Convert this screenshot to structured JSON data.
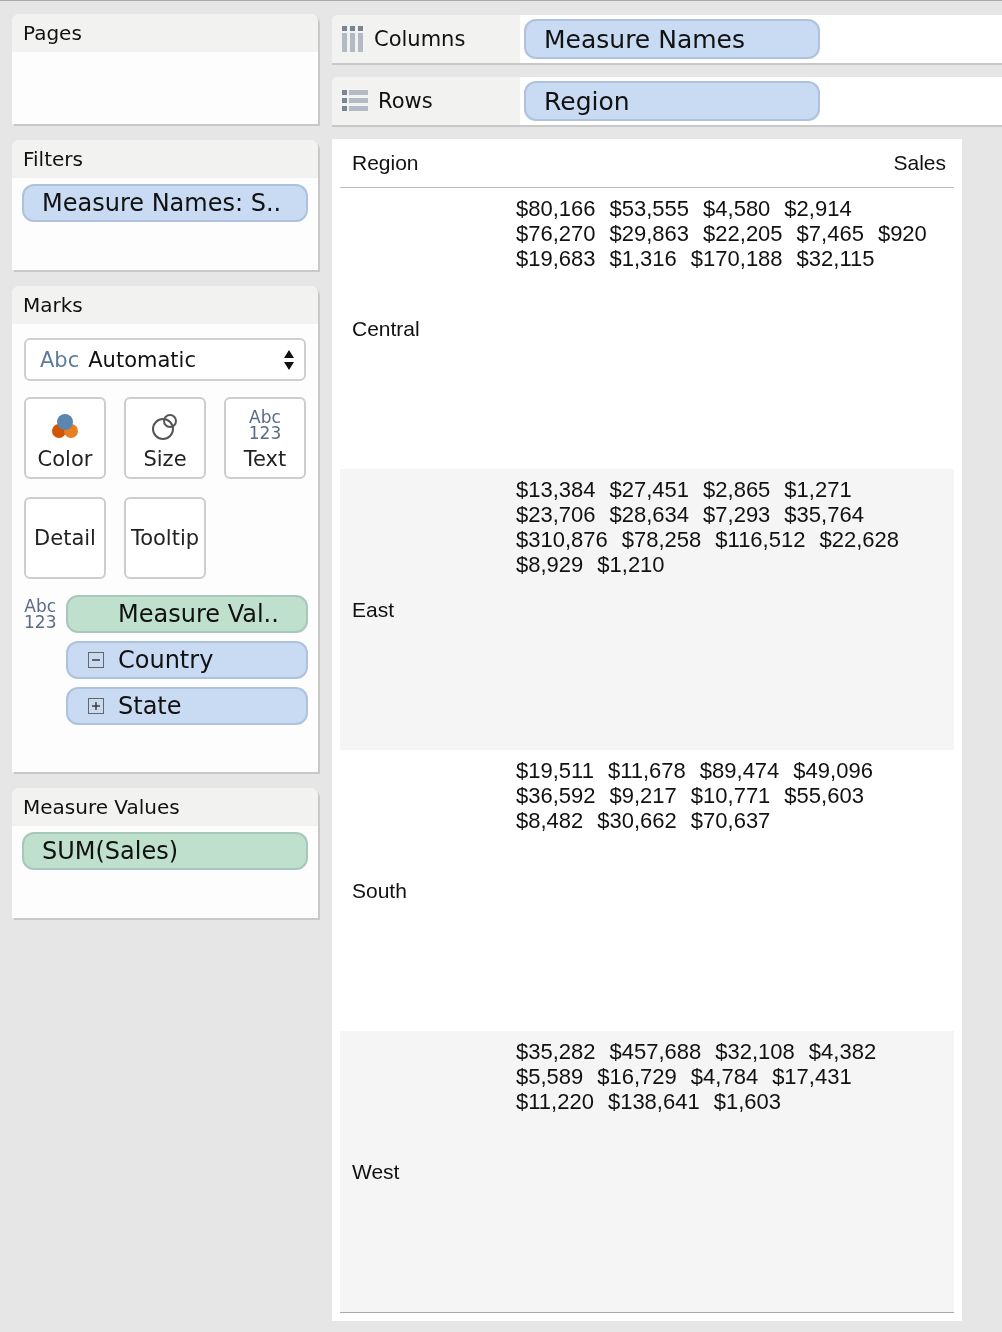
{
  "sidebar": {
    "pages": {
      "title": "Pages"
    },
    "filters": {
      "title": "Filters",
      "pills": [
        {
          "text": "Measure Names: S..",
          "color": "#c9daf3"
        }
      ]
    },
    "marks": {
      "title": "Marks",
      "mark_type": {
        "icon_text": "Abc",
        "value": "Automatic"
      },
      "buttons": [
        {
          "kind": "color",
          "label": "Color"
        },
        {
          "kind": "size",
          "label": "Size"
        },
        {
          "kind": "text",
          "label": "Text",
          "icon_lines": [
            "Abc",
            "123"
          ]
        },
        {
          "kind": "detail",
          "label": "Detail"
        },
        {
          "kind": "tooltip",
          "label": "Tooltip"
        }
      ],
      "encodings": [
        {
          "icon_lines": [
            "Abc",
            "123"
          ],
          "text": "Measure Val..",
          "color": "#bfe0cc"
        },
        {
          "text": "Country",
          "color": "#c9daf3",
          "expanded": true
        },
        {
          "text": "State",
          "color": "#c9daf3",
          "expanded": false
        }
      ]
    },
    "measure_values": {
      "title": "Measure Values",
      "pills": [
        {
          "text": "SUM(Sales)",
          "color": "#bfe0cc"
        }
      ]
    }
  },
  "shelves": [
    {
      "kind": "columns",
      "label": "Columns",
      "pills": [
        {
          "text": "Measure Names",
          "color": "#c9daf3"
        }
      ]
    },
    {
      "kind": "rows",
      "label": "Rows",
      "pills": [
        {
          "text": "Region",
          "color": "#c9daf3"
        }
      ]
    }
  ],
  "table": {
    "row_header": "Region",
    "measure_header": "Sales",
    "rows": [
      {
        "region": "Central",
        "lines": [
          [
            "$80,166",
            "$53,555",
            "$4,580",
            "$2,914"
          ],
          [
            "$76,270",
            "$29,863",
            "$22,205",
            "$7,465",
            "$920"
          ],
          [
            "$19,683",
            "$1,316",
            "$170,188",
            "$32,115"
          ]
        ]
      },
      {
        "region": "East",
        "lines": [
          [
            "$13,384",
            "$27,451",
            "$2,865",
            "$1,271"
          ],
          [
            "$23,706",
            "$28,634",
            "$7,293",
            "$35,764"
          ],
          [
            "$310,876",
            "$78,258",
            "$116,512",
            "$22,628"
          ],
          [
            "$8,929",
            "$1,210"
          ]
        ]
      },
      {
        "region": "South",
        "lines": [
          [
            "$19,511",
            "$11,678",
            "$89,474",
            "$49,096"
          ],
          [
            "$36,592",
            "$9,217",
            "$10,771",
            "$55,603"
          ],
          [
            "$8,482",
            "$30,662",
            "$70,637"
          ]
        ]
      },
      {
        "region": "West",
        "lines": [
          [
            "$35,282",
            "$457,688",
            "$32,108",
            "$4,382"
          ],
          [
            "$5,589",
            "$16,729",
            "$4,784",
            "$17,431"
          ],
          [
            "$11,220",
            "$138,641",
            "$1,603"
          ]
        ]
      }
    ]
  }
}
